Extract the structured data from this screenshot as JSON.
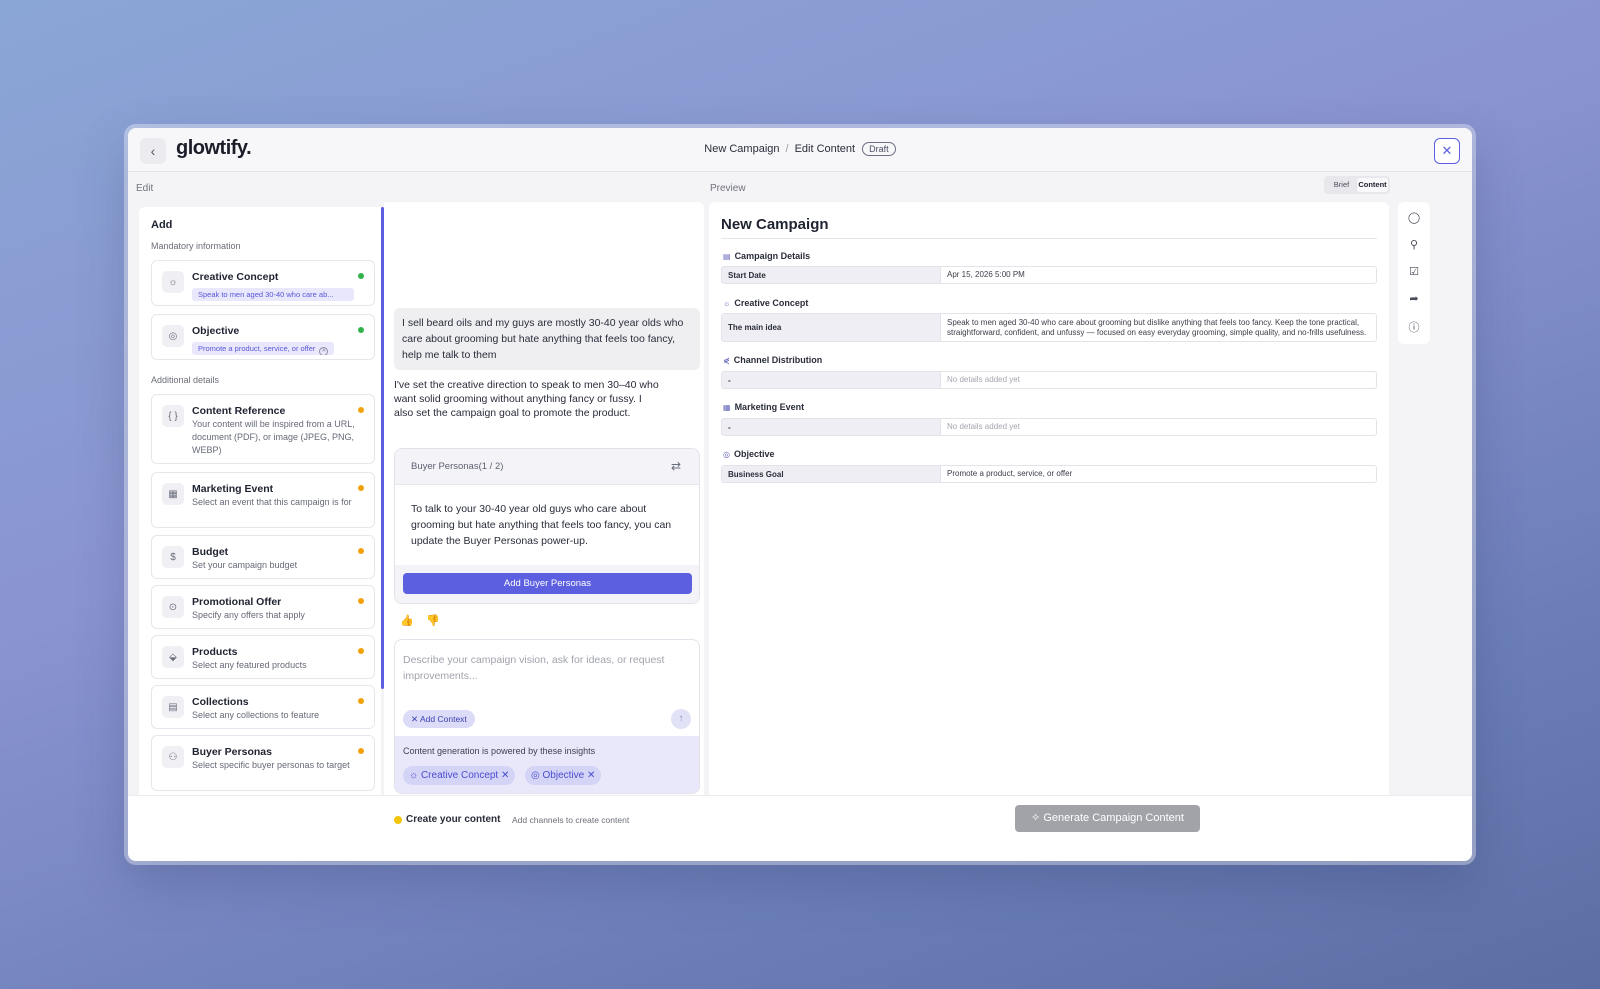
{
  "header": {
    "back_icon": "‹",
    "logo": "glowtify.",
    "breadcrumb": [
      "New Campaign",
      "Edit Content"
    ],
    "separator": "/",
    "status_badge": "Draft",
    "close_icon": "✕"
  },
  "edit_label": "Edit",
  "preview_label": "Preview",
  "view_toggle": {
    "brief": "Brief",
    "content": "Content",
    "active": "Content"
  },
  "left_panel": {
    "title": "Add",
    "mandatory_label": "Mandatory information",
    "additional_label": "Additional details",
    "mandatory": [
      {
        "title": "Creative Concept",
        "chip": "Speak to men aged 30-40 who care ab...",
        "status": "complete",
        "icon": "lightbulb-icon",
        "glyph": "☼"
      },
      {
        "title": "Objective",
        "chip": "Promote a product, service, or offer",
        "status": "complete",
        "icon": "target-icon",
        "glyph": "◎"
      }
    ],
    "additional": [
      {
        "title": "Content Reference",
        "desc": "Your content will be inspired from a URL, document (PDF), or image (JPEG, PNG, WEBP)",
        "icon": "braces-icon",
        "glyph": "{ }"
      },
      {
        "title": "Marketing Event",
        "desc": "Select an event that this campaign is for",
        "icon": "calendar-icon",
        "glyph": "▦"
      },
      {
        "title": "Budget",
        "desc": "Set your campaign budget",
        "icon": "dollar-icon",
        "glyph": "$"
      },
      {
        "title": "Promotional Offer",
        "desc": "Specify any offers that apply",
        "icon": "offer-icon",
        "glyph": "⊙"
      },
      {
        "title": "Products",
        "desc": "Select any featured products",
        "icon": "tag-icon",
        "glyph": "⬙"
      },
      {
        "title": "Collections",
        "desc": "Select any collections to feature",
        "icon": "archive-icon",
        "glyph": "▤"
      },
      {
        "title": "Buyer Personas",
        "desc": "Select specific buyer personas to target",
        "icon": "users-icon",
        "glyph": "⚇"
      }
    ]
  },
  "chat": {
    "user_message": "I sell beard oils and my guys are mostly 30-40 year olds who care about grooming but hate anything that feels too fancy, help me talk to them",
    "ai_message": "I've set the creative direction to speak to men 30–40 who want solid grooming without anything fancy or fussy. I also set the campaign goal to promote the product.",
    "persona_card": {
      "header": "Buyer Personas(1 / 2)",
      "swap_icon": "⇄",
      "body": "To talk to your 30-40 year old guys who care about grooming but hate anything that feels too fancy, you can update the Buyer Personas power-up.",
      "button": "Add Buyer Personas"
    },
    "thumbs_up": "👍",
    "thumbs_down": "👎",
    "composer": {
      "placeholder": "Describe your campaign vision, ask for ideas, or request improvements...",
      "add_context": "✕ Add Context",
      "send_icon": "↑"
    },
    "insights": {
      "label": "Content generation is powered by these insights",
      "chips": [
        "Creative Concept",
        "Objective"
      ],
      "chip_icons": [
        "☼",
        "◎"
      ],
      "remove_icon": "✕"
    }
  },
  "preview": {
    "title": "New Campaign",
    "sections": [
      {
        "title": "Campaign Details",
        "glyph": "▤",
        "key": "Start Date",
        "value": "Apr 15, 2026 5:00 PM"
      },
      {
        "title": "Creative Concept",
        "glyph": "☼",
        "key": "The main idea",
        "value": "Speak to men aged 30-40 who care about grooming but dislike anything that feels too fancy. Keep the tone practical, straightforward, confident, and unfussy — focused on easy everyday grooming, simple quality, and no-frills usefulness."
      },
      {
        "title": "Channel Distribution",
        "glyph": "⋞",
        "key": "-",
        "value": "No details added yet"
      },
      {
        "title": "Marketing Event",
        "glyph": "▦",
        "key": "-",
        "value": "No details added yet"
      },
      {
        "title": "Objective",
        "glyph": "◎",
        "key": "Business Goal",
        "value": "Promote a product, service, or offer"
      }
    ]
  },
  "side_tools": [
    {
      "name": "comment-icon",
      "glyph": "◯"
    },
    {
      "name": "user-icon",
      "glyph": "⚲"
    },
    {
      "name": "checklist-icon",
      "glyph": "☑"
    },
    {
      "name": "share-icon",
      "glyph": "➦"
    },
    {
      "name": "info-icon",
      "glyph": "ⓘ"
    }
  ],
  "footer": {
    "title": "Create your content",
    "subtitle": "Add channels to create content",
    "generate_icon": "✧",
    "generate_button": "Generate Campaign Content"
  },
  "colors": {
    "accent": "#5b5fe0",
    "complete": "#33b24a",
    "pending": "#f2a20c",
    "footer_dot": "#f2c40c"
  }
}
